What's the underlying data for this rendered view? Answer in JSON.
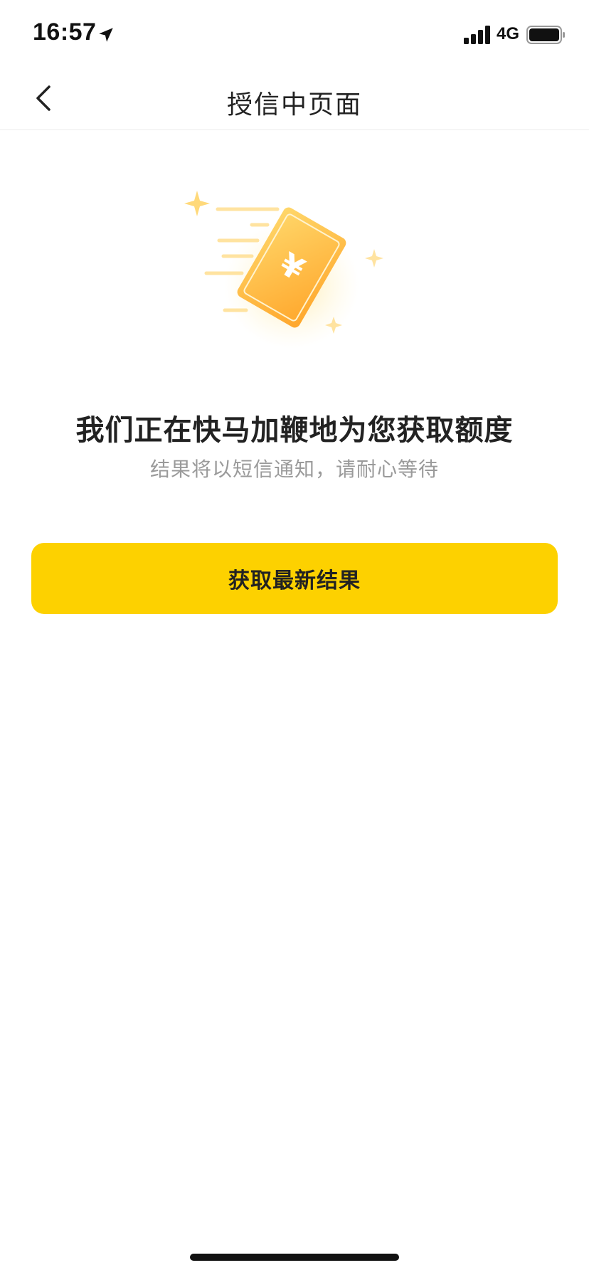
{
  "status_bar": {
    "time": "16:57",
    "network": "4G",
    "icons": [
      "location-arrow-icon",
      "signal-bars-icon",
      "battery-icon"
    ]
  },
  "nav": {
    "title": "授信中页面",
    "back_icon": "chevron-left-icon"
  },
  "illustration": {
    "icon": "money-card-icon",
    "card_symbol": "¥"
  },
  "main": {
    "headline": "我们正在快马加鞭地为您获取额度",
    "subtext": "结果将以短信通知，请耐心等待",
    "primary_button_label": "获取最新结果"
  },
  "colors": {
    "accent": "#fdd100",
    "card_gradient_start": "#ffd76a",
    "card_gradient_end": "#ffa62b",
    "headline": "#222222",
    "subtext": "#9a9a9a"
  }
}
